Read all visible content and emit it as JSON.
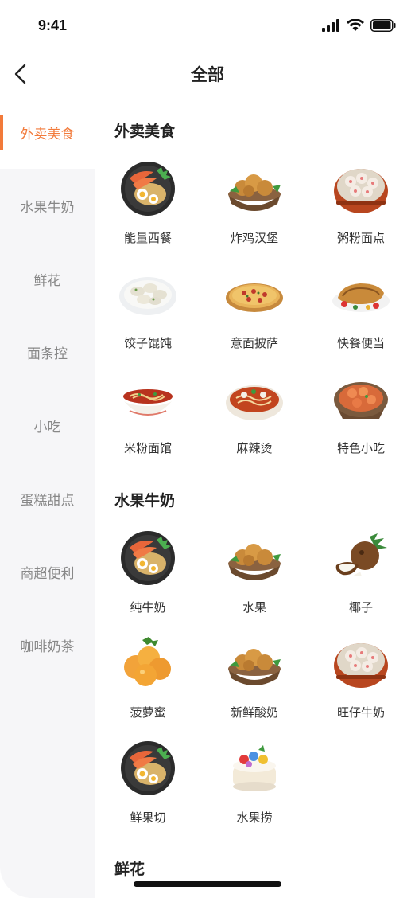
{
  "status_bar": {
    "time": "9:41"
  },
  "nav": {
    "title": "全部"
  },
  "sidebar": {
    "items": [
      {
        "label": "外卖美食",
        "active": true
      },
      {
        "label": "水果牛奶",
        "active": false
      },
      {
        "label": "鲜花",
        "active": false
      },
      {
        "label": "面条控",
        "active": false
      },
      {
        "label": "小吃",
        "active": false
      },
      {
        "label": "蛋糕甜点",
        "active": false
      },
      {
        "label": "商超便利",
        "active": false
      },
      {
        "label": "咖啡奶茶",
        "active": false
      }
    ]
  },
  "sections": [
    {
      "title": "外卖美食",
      "items": [
        {
          "label": "能量西餐",
          "icon": "bowl-shrimp-icon"
        },
        {
          "label": "炸鸡汉堡",
          "icon": "fried-chicken-icon"
        },
        {
          "label": "粥粉面点",
          "icon": "dumpling-steamer-icon"
        },
        {
          "label": "饺子馄饨",
          "icon": "dumplings-plate-icon"
        },
        {
          "label": "意面披萨",
          "icon": "pizza-icon"
        },
        {
          "label": "快餐便当",
          "icon": "grilled-fish-icon"
        },
        {
          "label": "米粉面馆",
          "icon": "noodle-bowl-icon"
        },
        {
          "label": "麻辣烫",
          "icon": "spicy-hotpot-icon"
        },
        {
          "label": "特色小吃",
          "icon": "shrimp-dish-icon"
        }
      ]
    },
    {
      "title": "水果牛奶",
      "items": [
        {
          "label": "纯牛奶",
          "icon": "bowl-shrimp-icon"
        },
        {
          "label": "水果",
          "icon": "fried-chicken-icon"
        },
        {
          "label": "椰子",
          "icon": "coconut-icon"
        },
        {
          "label": "菠萝蜜",
          "icon": "peach-icon"
        },
        {
          "label": "新鲜酸奶",
          "icon": "fried-chicken-icon"
        },
        {
          "label": "旺仔牛奶",
          "icon": "dumpling-steamer-icon"
        },
        {
          "label": "鲜果切",
          "icon": "bowl-shrimp-icon"
        },
        {
          "label": "水果捞",
          "icon": "fruit-cake-icon"
        }
      ]
    },
    {
      "title": "鲜花",
      "items": []
    }
  ]
}
